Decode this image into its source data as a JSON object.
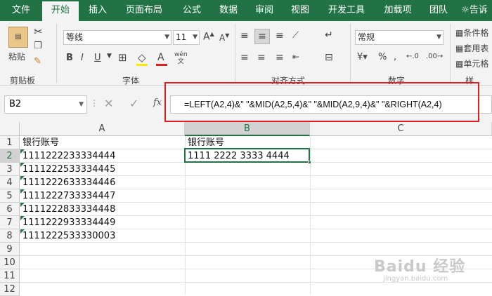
{
  "tabs": [
    "文件",
    "开始",
    "插入",
    "页面布局",
    "公式",
    "数据",
    "审阅",
    "视图",
    "开发工具",
    "加载项",
    "团队",
    "告诉"
  ],
  "ribbon": {
    "clipboard": {
      "paste_label": "粘贴",
      "group_label": "剪贴板"
    },
    "font": {
      "name": "等线",
      "size": "11",
      "group_label": "字体",
      "phonetic": "wén"
    },
    "alignment": {
      "group_label": "对齐方式"
    },
    "number": {
      "format": "常规",
      "group_label": "数字"
    },
    "styles": {
      "items": [
        "条件格",
        "套用表",
        "单元格"
      ],
      "group_label": "样"
    }
  },
  "formula_bar": {
    "name_box": "B2",
    "fx": "fx",
    "formula": "=LEFT(A2,4)&\" \"&MID(A2,5,4)&\" \"&MID(A2,9,4)&\" \"&RIGHT(A2,4)"
  },
  "sheet": {
    "columns": [
      "A",
      "B",
      "C"
    ],
    "rows": [
      "1",
      "2",
      "3",
      "4",
      "5",
      "6",
      "7",
      "8",
      "9",
      "10",
      "11",
      "12"
    ],
    "col_a": [
      "银行账号",
      "1111222233334444",
      "1111222533334445",
      "1111222633334446",
      "1111222733334447",
      "1111222833334448",
      "1111222933334449",
      "1111222533330003"
    ],
    "b1": "银行账号",
    "b2": "1111 2222 3333 4444"
  },
  "watermark": {
    "text": "Baidu 经验",
    "sub": "jingyan.baidu.com"
  },
  "colors": {
    "accent": "#217346",
    "highlight": "#e02020"
  }
}
